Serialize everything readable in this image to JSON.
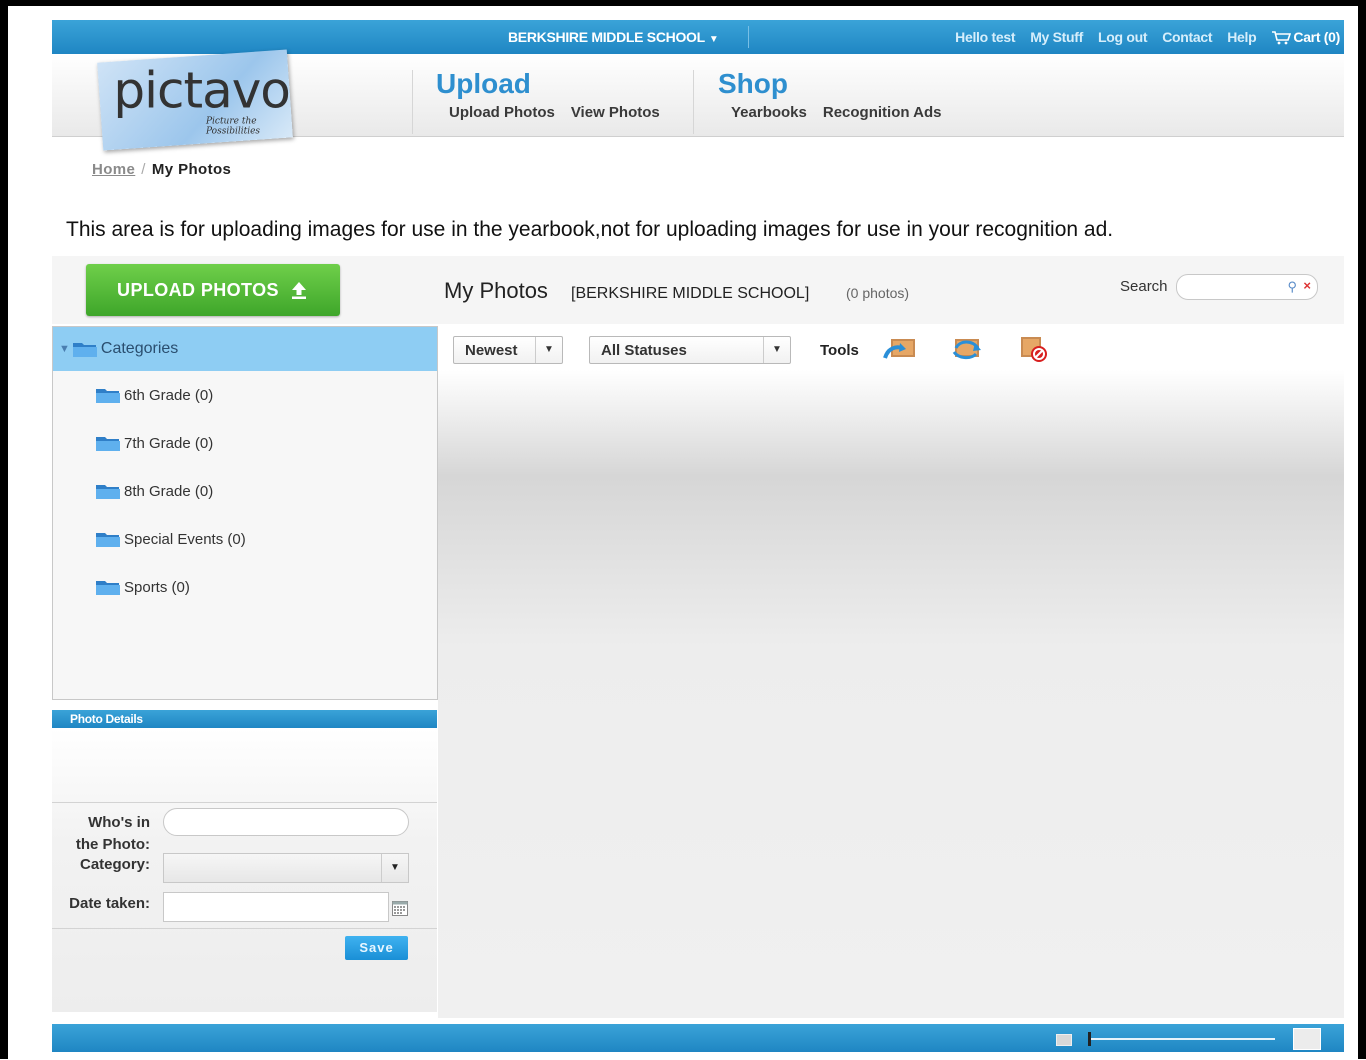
{
  "topbar": {
    "school": "BERKSHIRE MIDDLE SCHOOL",
    "links": [
      "Hello test",
      "My Stuff",
      "Log out",
      "Contact",
      "Help"
    ],
    "cart": "Cart (0)"
  },
  "logo": {
    "word": "pictavo",
    "tagline": "Picture the Possibilities"
  },
  "nav": {
    "upload": {
      "title": "Upload",
      "items": [
        "Upload Photos",
        "View Photos"
      ]
    },
    "shop": {
      "title": "Shop",
      "items": [
        "Yearbooks",
        "Recognition Ads"
      ]
    }
  },
  "breadcrumb": {
    "home": "Home",
    "sep": "/",
    "current": "My Photos"
  },
  "notice": "This area is for uploading images for use in the yearbook,not for uploading images for use in your recognition ad.",
  "toolbar": {
    "upload_button": "UPLOAD PHOTOS",
    "title": "My Photos",
    "school": "[BERKSHIRE MIDDLE SCHOOL]",
    "count": "(0 photos)",
    "search_label": "Search",
    "search_value": ""
  },
  "categories": {
    "header": "Categories",
    "items": [
      "6th Grade (0)",
      "7th Grade (0)",
      "8th Grade (0)",
      "Special Events (0)",
      "Sports (0)"
    ]
  },
  "photo_details": {
    "header": "Photo Details",
    "who_label_1": "Who's in",
    "who_label_2": "the Photo:",
    "category_label": "Category:",
    "date_label": "Date taken:",
    "who_value": "",
    "category_value": "",
    "date_value": "",
    "save": "Save"
  },
  "main": {
    "sort": "Newest",
    "status": "All Statuses",
    "tools_label": "Tools",
    "tools": [
      "move-photo-icon",
      "rotate-photo-icon",
      "delete-photo-icon"
    ]
  },
  "colors": {
    "accent": "#2e8fcf",
    "upload_green": "#4cb534",
    "topbar": "#2a94cd"
  }
}
